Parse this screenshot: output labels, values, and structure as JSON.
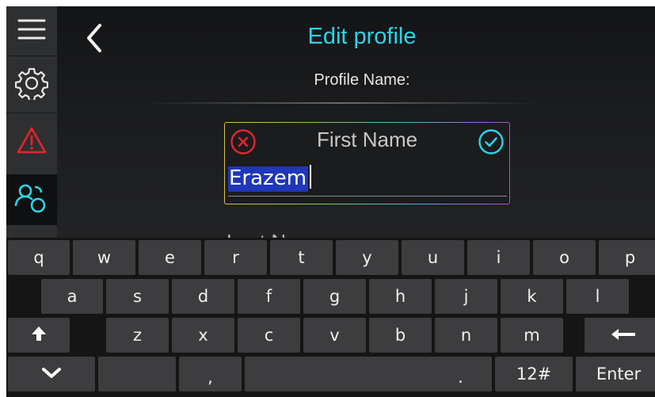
{
  "header": {
    "title": "Edit profile",
    "profile_label": "Profile Name:"
  },
  "sidebar": {
    "items": [
      {
        "icon": "menu-icon"
      },
      {
        "icon": "gear-icon"
      },
      {
        "icon": "warning-icon",
        "color": "#e5242b"
      },
      {
        "icon": "users-icon",
        "color": "#2ad6e8",
        "active": true
      }
    ]
  },
  "form": {
    "first_name": {
      "label": "First Name",
      "value": "Erazem"
    },
    "next_field_label": "Last Name"
  },
  "keyboard": {
    "row1": [
      "q",
      "w",
      "e",
      "r",
      "t",
      "y",
      "u",
      "i",
      "o",
      "p"
    ],
    "row2": [
      "a",
      "s",
      "d",
      "f",
      "g",
      "h",
      "j",
      "k",
      "l"
    ],
    "row3": [
      "z",
      "x",
      "c",
      "v",
      "b",
      "n",
      "m"
    ],
    "comma": ",",
    "period": ".",
    "mode": "12#",
    "enter": "Enter"
  },
  "colors": {
    "accent": "#2ad6e8",
    "error": "#e5242b",
    "selection": "#1f37b8"
  }
}
